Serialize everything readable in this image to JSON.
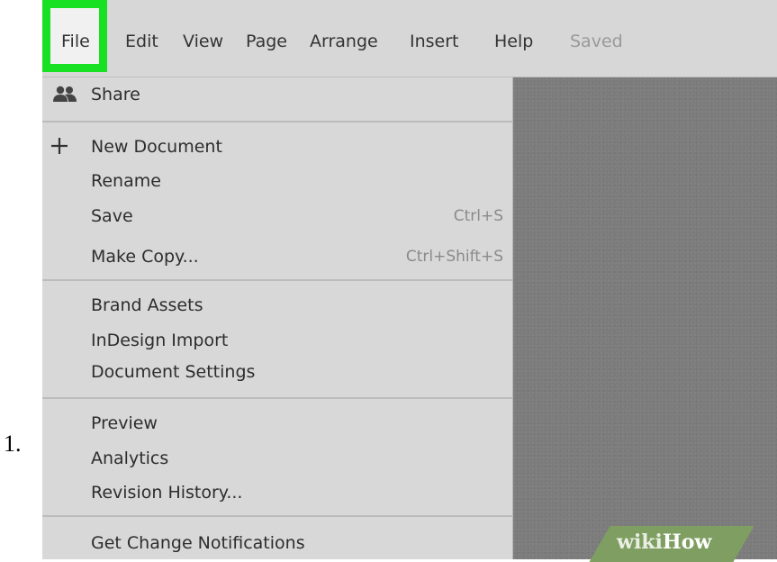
{
  "step": {
    "number": "1."
  },
  "menubar": {
    "items": [
      {
        "label": "File"
      },
      {
        "label": "Edit"
      },
      {
        "label": "View"
      },
      {
        "label": "Page"
      },
      {
        "label": "Arrange"
      },
      {
        "label": "Insert"
      },
      {
        "label": "Help"
      }
    ],
    "status": "Saved",
    "highlight_color": "#18e023"
  },
  "file_menu": {
    "groups": [
      [
        {
          "label": "Share",
          "icon": "users-icon"
        }
      ],
      [
        {
          "label": "New Document",
          "icon": "plus-icon"
        },
        {
          "label": "Rename"
        },
        {
          "label": "Save",
          "shortcut": "Ctrl+S"
        },
        {
          "label": "Make Copy...",
          "shortcut": "Ctrl+Shift+S"
        }
      ],
      [
        {
          "label": "Brand Assets"
        },
        {
          "label": "InDesign Import"
        },
        {
          "label": "Document Settings"
        }
      ],
      [
        {
          "label": "Preview"
        },
        {
          "label": "Analytics"
        },
        {
          "label": "Revision History..."
        }
      ],
      [
        {
          "label": "Get Change Notifications"
        }
      ]
    ]
  },
  "watermark": {
    "part1": "wiki",
    "part2": "How"
  }
}
